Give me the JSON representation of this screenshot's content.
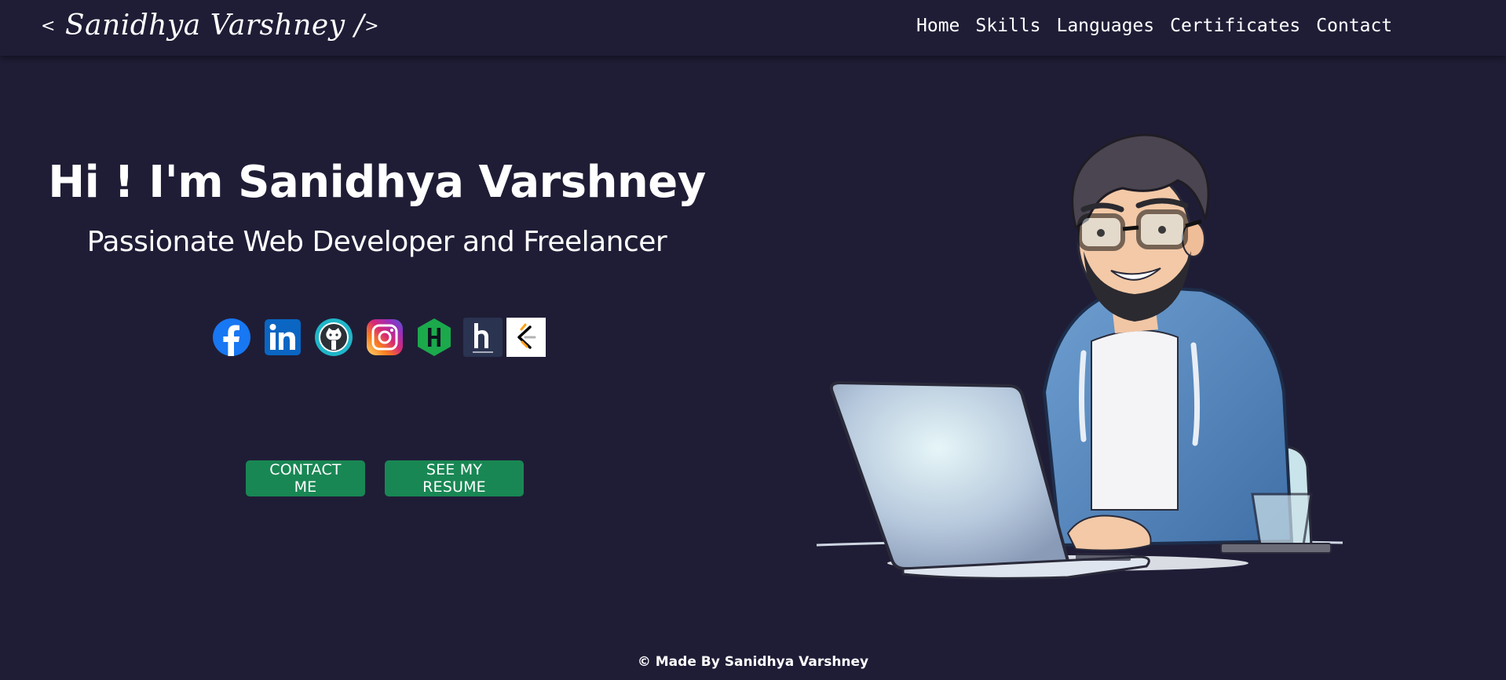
{
  "brand": {
    "open": "<",
    "name": "Sanidhya Varshney /",
    "close": ">"
  },
  "nav": {
    "items": [
      "Home",
      "Skills",
      "Languages",
      "Certificates",
      "Contact"
    ]
  },
  "hero": {
    "title": "Hi ! I'm Sanidhya Varshney",
    "subtitle": "Passionate Web Developer and Freelancer"
  },
  "socials": [
    {
      "icon": "facebook-icon",
      "color": "#1877f2"
    },
    {
      "icon": "linkedin-icon",
      "color": "#0a66c2"
    },
    {
      "icon": "github-icon",
      "color": "#1fb5c8"
    },
    {
      "icon": "instagram-icon",
      "color": "#d62976"
    },
    {
      "icon": "hackerrank-icon",
      "color": "#00ea64"
    },
    {
      "icon": "hashnode-icon",
      "color": "#2a3350"
    },
    {
      "icon": "leetcode-icon",
      "color": "#ffa116"
    }
  ],
  "buttons": {
    "contact": "CONTACT ME",
    "resume": "SEE MY RESUME"
  },
  "illustration": {
    "icon": "developer-with-laptop-illustration"
  },
  "footer": {
    "text": "© Made By Sanidhya Varshney"
  },
  "colors": {
    "background": "#1f1d36",
    "button": "#198754",
    "text": "#ffffff"
  }
}
